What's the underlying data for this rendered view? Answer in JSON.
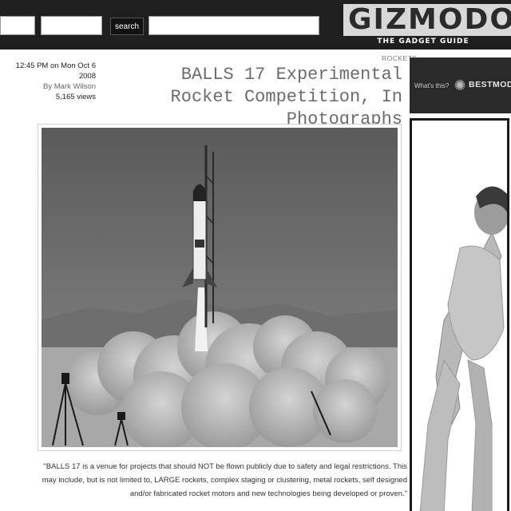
{
  "header": {
    "search_label": "search",
    "logo_word": "GIZMODO",
    "logo_tagline": "THE GADGET GUIDE"
  },
  "meta": {
    "time": "12:45 PM on Mon Oct 6 2008",
    "author": "By Mark Wilson",
    "views": "5,165 views"
  },
  "article": {
    "category": "ROCKETS",
    "title": "BALLS 17 Experimental Rocket Competition, In Photographs",
    "caption": "\"BALLS 17 is a venue for projects that should NOT be flown publicly due to safety and legal restrictions. This may include, but is not limited to, LARGE rockets, complex staging or clustering, metal rockets, self designed and/or fabricated rocket motors and new technologies being developed or proven.\""
  },
  "bestmodo": {
    "logo": "BESTMODO",
    "what": "What's this?"
  },
  "colors": {
    "topbar": "#1f1f1f",
    "headline": "#6c6c6c",
    "widget": "#2a2a2a"
  },
  "icons": [
    "star-logo-icon",
    "tripod-icon"
  ]
}
